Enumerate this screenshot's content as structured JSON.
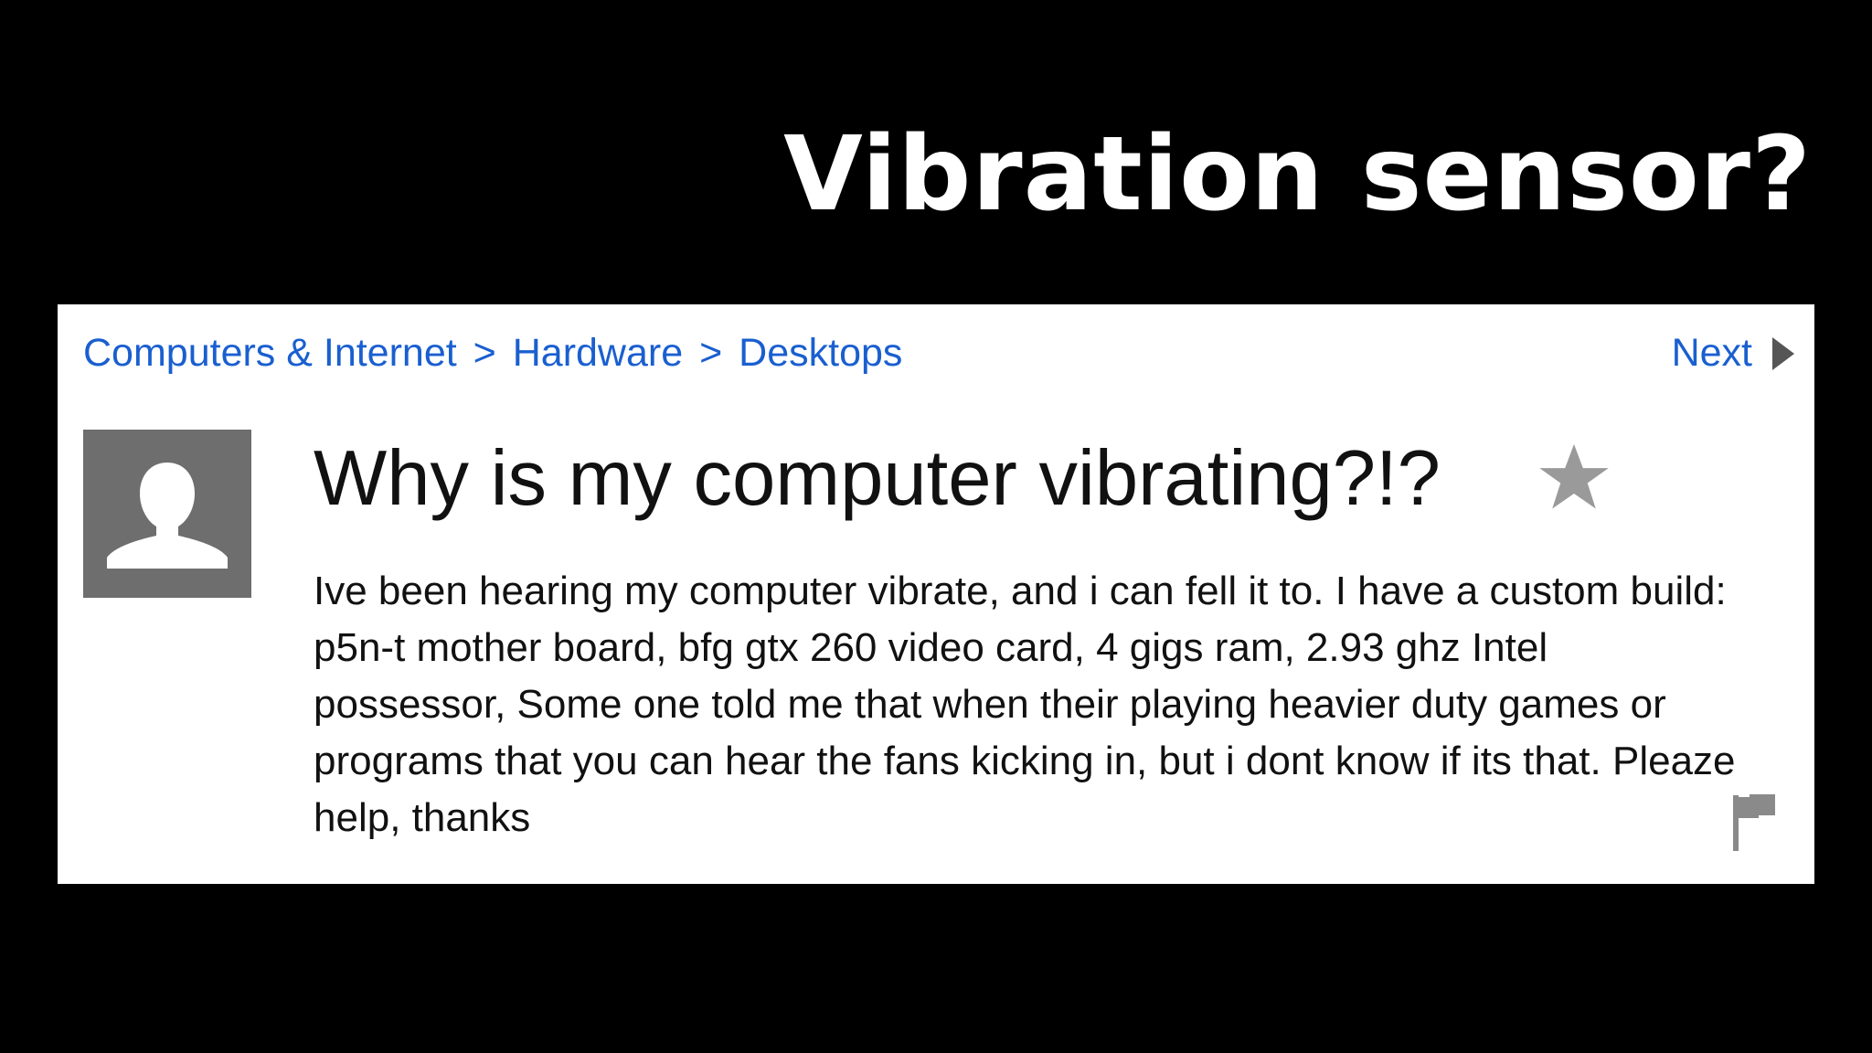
{
  "slide": {
    "title": "Vibration sensor?"
  },
  "breadcrumb": {
    "items": [
      "Computers & Internet",
      "Hardware",
      "Desktops"
    ],
    "separator": ">"
  },
  "nav": {
    "next_label": "Next"
  },
  "question": {
    "title": "Why is my computer vibrating?!?",
    "body": "Ive been hearing my computer vibrate, and i can fell it to. I have a custom build: p5n-t mother board, bfg gtx 260 video card, 4 gigs ram, 2.93 ghz Intel possessor, Some one told me that when their playing heavier duty games or programs that you can hear the fans kicking in, but i dont know if its that. Pleaze help, thanks"
  },
  "icons": {
    "avatar": "default-user-avatar",
    "star": "star-icon",
    "flag": "flag-icon",
    "next": "play-triangle-icon"
  },
  "colors": {
    "link": "#1a5fd0",
    "background": "#000000",
    "card": "#ffffff",
    "avatar_bg": "#6e6e6e"
  }
}
